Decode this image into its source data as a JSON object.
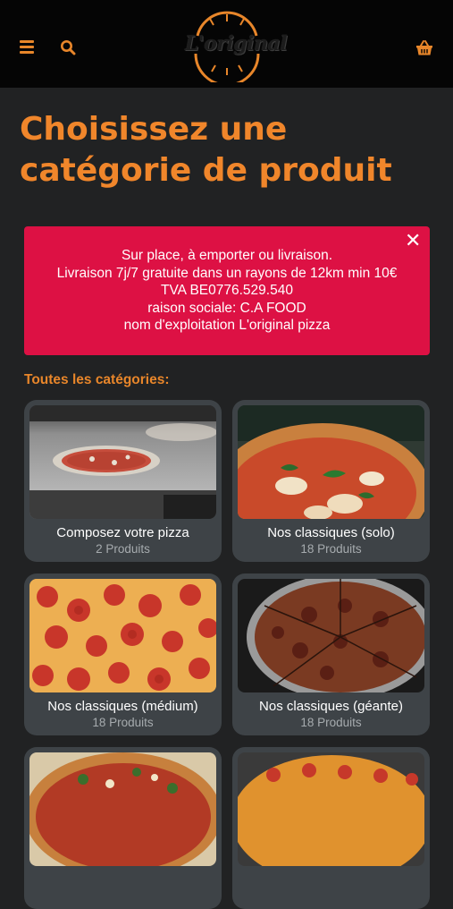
{
  "header": {
    "menu_icon": "hamburger-menu-icon",
    "search_icon": "search-icon",
    "cart_icon": "shopping-basket-icon",
    "logo_text": "L'original",
    "accent_color": "#e8862a"
  },
  "page": {
    "title": "Choisissez une catégorie de produit"
  },
  "alert": {
    "lines": [
      "Sur place, à emporter ou livraison.",
      "Livraison 7j/7 gratuite dans un rayons de 12km min 10€",
      "TVA  BE0776.529.540",
      "raison sociale: C.A FOOD",
      "nom d'exploitation L'original pizza"
    ],
    "close_icon": "close-icon",
    "color": "#dd1144"
  },
  "categories": {
    "label": "Toutes les catégories:",
    "items": [
      {
        "name": "Composez votre pizza",
        "count": "2 Produits"
      },
      {
        "name": "Nos classiques (solo)",
        "count": "18 Produits"
      },
      {
        "name": "Nos classiques (médium)",
        "count": "18 Produits"
      },
      {
        "name": "Nos classiques (géante)",
        "count": "18 Produits"
      },
      {
        "name": "",
        "count": ""
      },
      {
        "name": "",
        "count": ""
      }
    ]
  }
}
